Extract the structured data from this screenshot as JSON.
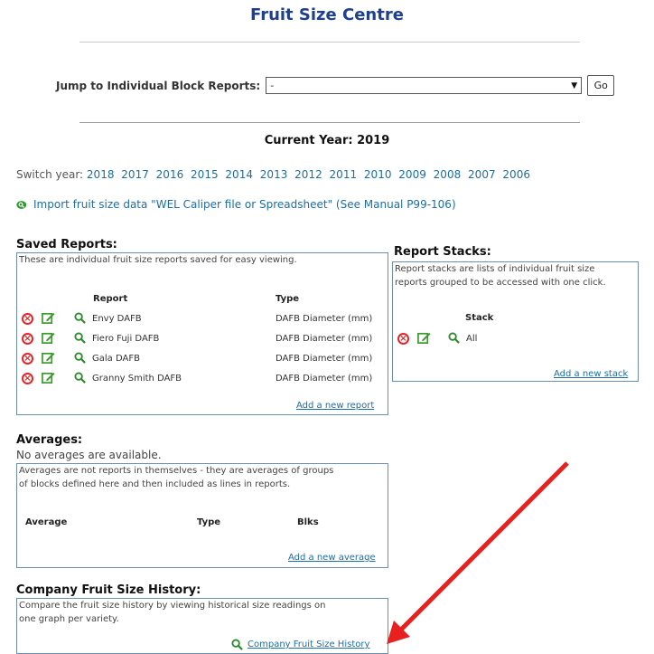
{
  "page_title": "Fruit Size Centre",
  "jump": {
    "label": "Jump to Individual Block Reports:",
    "selected": "-",
    "go_label": "Go"
  },
  "current_year": "Current Year: 2019",
  "switch_year": {
    "label": "Switch year:",
    "years": [
      "2018",
      "2017",
      "2016",
      "2015",
      "2014",
      "2013",
      "2012",
      "2011",
      "2010",
      "2009",
      "2008",
      "2007",
      "2006"
    ]
  },
  "import_link": "Import fruit size data \"WEL Caliper file or Spreadsheet\" (See Manual P99-106)",
  "saved_reports": {
    "title": "Saved Reports:",
    "description": "These are individual fruit size reports saved for easy viewing.",
    "col_report": "Report",
    "col_type": "Type",
    "rows": [
      {
        "report": "Envy DAFB",
        "type": "DAFB Diameter (mm)"
      },
      {
        "report": "Fiero Fuji DAFB",
        "type": "DAFB Diameter (mm)"
      },
      {
        "report": "Gala DAFB",
        "type": "DAFB Diameter (mm)"
      },
      {
        "report": "Granny Smith DAFB",
        "type": "DAFB Diameter (mm)"
      }
    ],
    "add_link": "Add a new report"
  },
  "report_stacks": {
    "title": "Report Stacks:",
    "description_line1": "Report stacks are lists of individual fruit size",
    "description_line2": "reports grouped to be accessed with one click.",
    "col_stack": "Stack",
    "rows": [
      {
        "stack": "All"
      }
    ],
    "add_link": "Add a new stack"
  },
  "averages": {
    "title": "Averages:",
    "none_text": "No averages are available.",
    "description_line1": "Averages are not reports in themselves - they are averages of groups",
    "description_line2": "of blocks defined here and then included as lines in reports.",
    "col_average": "Average",
    "col_type": "Type",
    "col_blks": "Blks",
    "add_link": "Add a new average"
  },
  "history": {
    "title": "Company Fruit Size History:",
    "description_line1": "Compare the fruit size history by viewing historical size readings on",
    "description_line2": "one graph per variety.",
    "link": "Company Fruit Size History"
  },
  "colors": {
    "title": "#1f3f8f",
    "link": "#1c6ea4",
    "delete": "#e0262a",
    "edit": "#3a9a2a",
    "arrow": "#e8201e"
  }
}
